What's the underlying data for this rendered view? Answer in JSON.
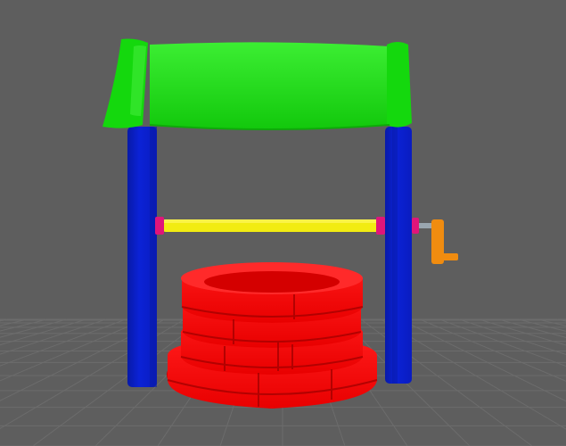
{
  "scene": {
    "subject": "wishing-well-3d-model",
    "colors": {
      "background": "#5e5e5e",
      "grid_line": "#6c6c6c",
      "roof": "#17e010",
      "roof_highlight": "#4cf044",
      "post": "#0b22d6",
      "post_shade": "#081aa8",
      "axle": "#f2ec12",
      "axle_cap": "#e0157a",
      "crank": "#f08c10",
      "crank_rod": "#9aa6b0",
      "bricks": "#ff0a0a",
      "bricks_shade": "#c70000"
    },
    "icons": {
      "roof": "roof-icon",
      "posts": "post-icon",
      "axle": "axle-icon",
      "crank": "crank-handle-icon",
      "well_ring": "well-wall-icon"
    }
  }
}
